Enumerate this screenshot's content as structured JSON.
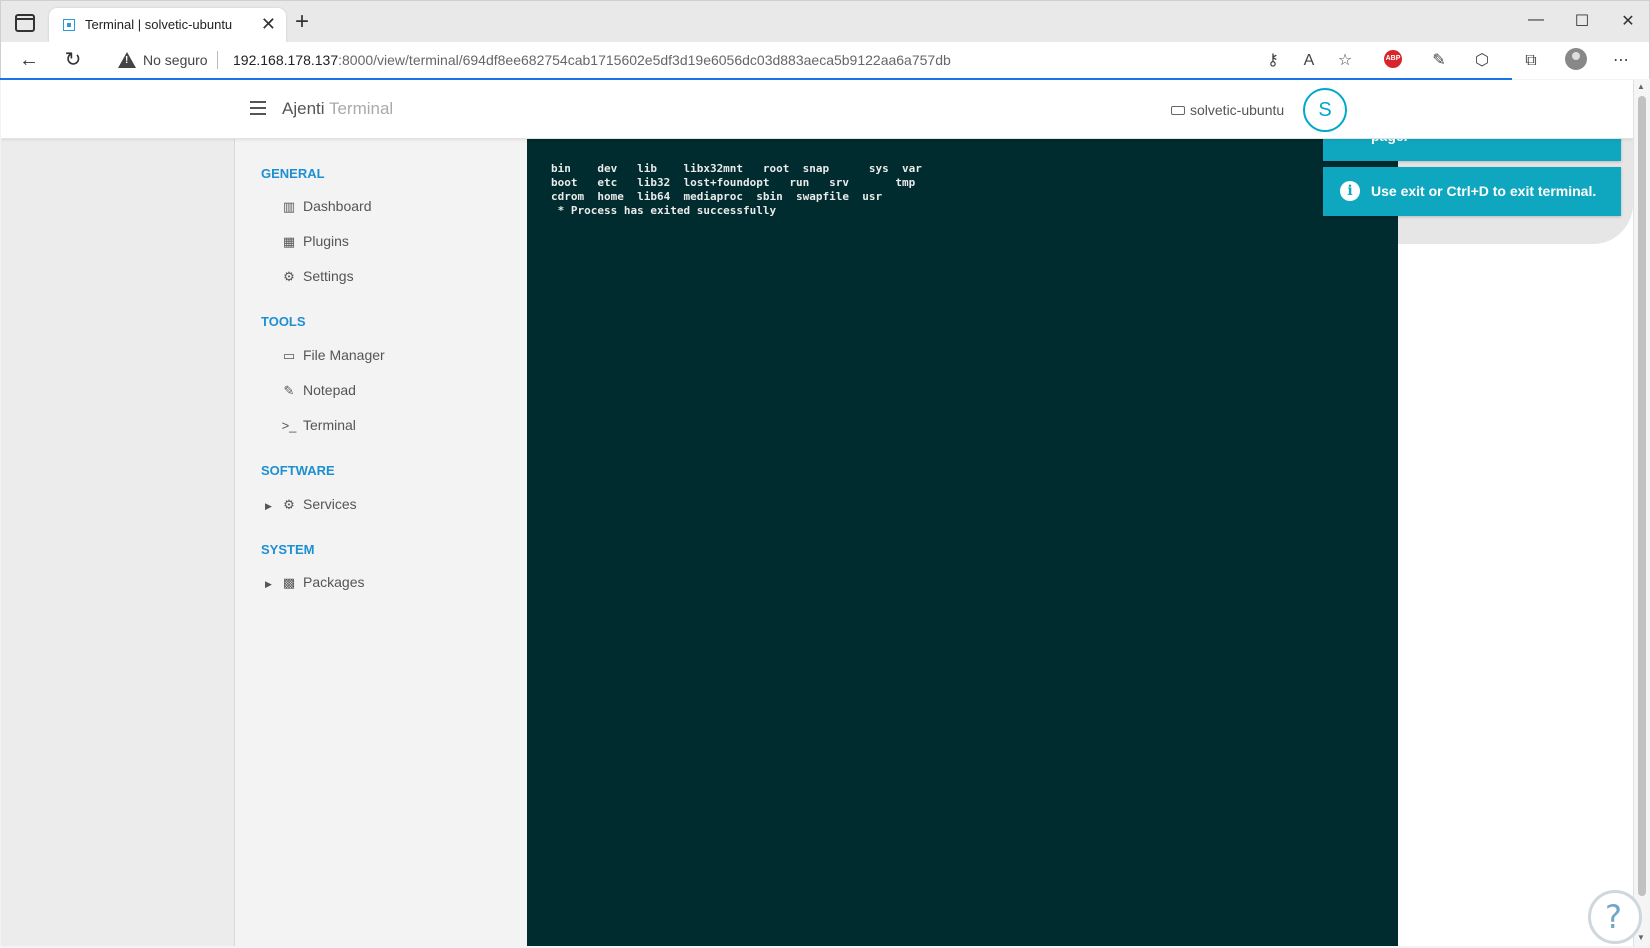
{
  "browser": {
    "tab_title": "Terminal | solvetic-ubuntu",
    "tab_close": "✕",
    "new_tab": "+",
    "security_label": "No seguro",
    "url_host": "192.168.178.137",
    "url_rest": ":8000/view/terminal/694df8ee682754cab1715602e5df3d19e6056dc03d883aeca5b9122aa6a757db",
    "window_controls": {
      "minimize": "—",
      "maximize": "☐",
      "close": "✕"
    },
    "nav": {
      "back": "←",
      "reload": "↻"
    },
    "extension_label": "ABP",
    "toolbar_icons": [
      "key-icon",
      "read-aloud-icon",
      "favorites-icon",
      "adblock-icon",
      "extension-icon",
      "puzzle-icon",
      "collections-icon",
      "profile-icon",
      "more-icon"
    ]
  },
  "app": {
    "brand": "Ajenti",
    "brand_sub": "Terminal",
    "hostname": "solvetic-ubuntu",
    "user_initial": "S"
  },
  "sidebar": {
    "sections": [
      {
        "title": "GENERAL",
        "items": [
          {
            "label": "Dashboard",
            "icon": "chart-icon"
          },
          {
            "label": "Plugins",
            "icon": "grid-icon"
          },
          {
            "label": "Settings",
            "icon": "gear-icon"
          }
        ]
      },
      {
        "title": "TOOLS",
        "items": [
          {
            "label": "File Manager",
            "icon": "folder-icon"
          },
          {
            "label": "Notepad",
            "icon": "pencil-icon"
          },
          {
            "label": "Terminal",
            "icon": "terminal-icon"
          }
        ]
      },
      {
        "title": "SOFTWARE",
        "items": [
          {
            "label": "Services",
            "icon": "gears-icon"
          }
        ]
      },
      {
        "title": "SYSTEM",
        "items": [
          {
            "label": "Packages",
            "icon": "gift-icon"
          }
        ]
      }
    ]
  },
  "terminal": {
    "output": "bin    dev   lib    libx32mnt   root  snap      sys  var\nboot   etc   lib32  lost+foundopt   run   srv       tmp\ncdrom  home  lib64  mediaproc  sbin  swapfile  usr\n * Process has exited successfully"
  },
  "toasts": [
    {
      "message": "You will be redirect to the previous page."
    },
    {
      "message": "Use exit or Ctrl+D to exit terminal."
    }
  ],
  "colors": {
    "accent": "#1e8fd0",
    "terminal_bg": "#002b2f",
    "toast_bg": "#0fa7bf"
  }
}
